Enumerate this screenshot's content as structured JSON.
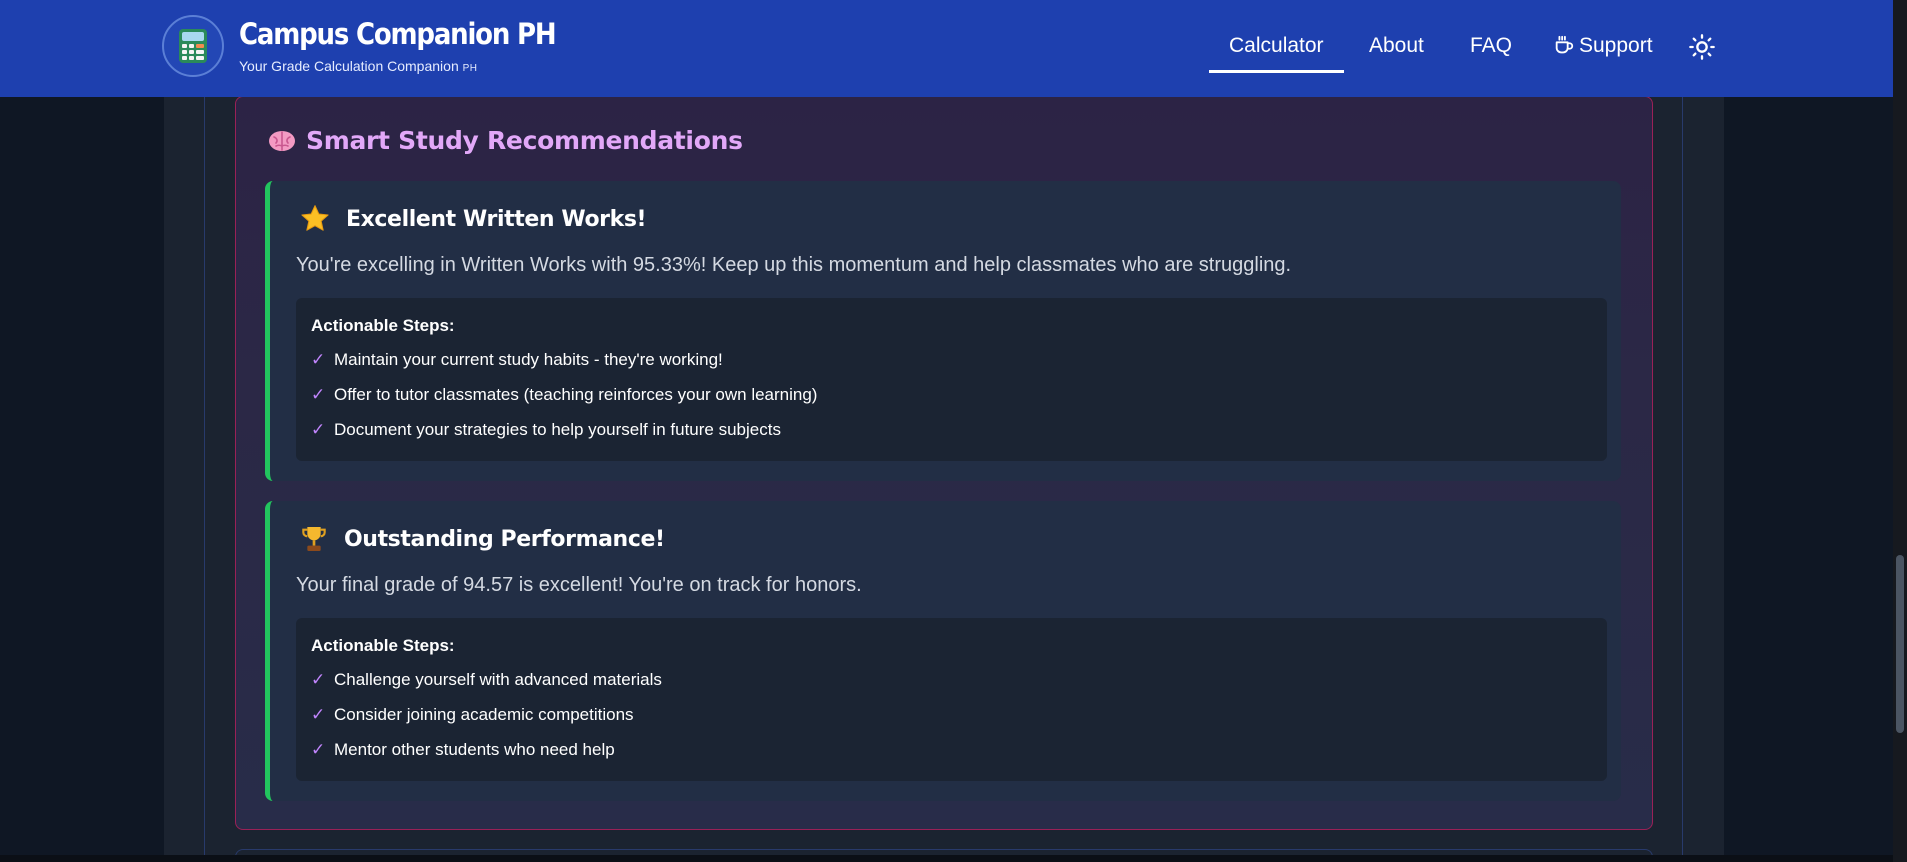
{
  "header": {
    "app_title": "Campus Companion PH",
    "subtitle": "Your Grade Calculation Companion",
    "subtitle_suffix": "PH",
    "logo_icon": "calculator-icon",
    "nav": [
      {
        "label": "Calculator",
        "active": true
      },
      {
        "label": "About",
        "active": false
      },
      {
        "label": "FAQ",
        "active": false
      },
      {
        "label": "Support",
        "icon": "coffee-cup-icon",
        "active": false
      }
    ],
    "theme_toggle_icon": "sun-icon"
  },
  "recommendations": {
    "title": "Smart Study Recommendations",
    "title_icon": "brain-icon",
    "title_color": "#e2a8f8",
    "accent_color": "#22c55e",
    "cards": [
      {
        "icon": "star-icon",
        "title": "Excellent Written Works!",
        "description": "You're excelling in Written Works with 95.33%! Keep up this momentum and help classmates who are struggling.",
        "steps_heading": "Actionable Steps:",
        "steps": [
          "Maintain your current study habits - they're working!",
          "Offer to tutor classmates (teaching reinforces your own learning)",
          "Document your strategies to help yourself in future subjects"
        ]
      },
      {
        "icon": "trophy-icon",
        "title": "Outstanding Performance!",
        "description": "Your final grade of 94.57 is excellent! You're on track for honors.",
        "steps_heading": "Actionable Steps:",
        "steps": [
          "Challenge yourself with advanced materials",
          "Consider joining academic competitions",
          "Mentor other students who need help"
        ]
      }
    ]
  },
  "check_symbol": "✓"
}
